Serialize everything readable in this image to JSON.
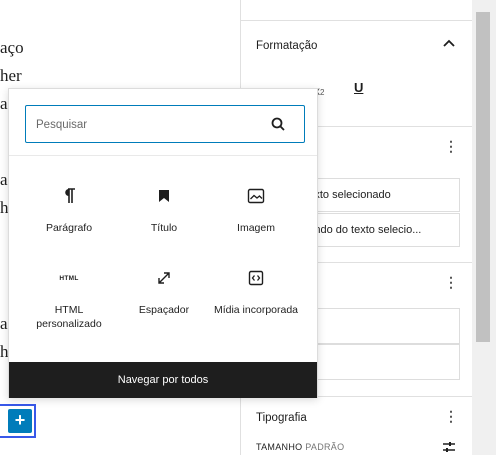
{
  "editor": {
    "fragments": [
      "aço",
      "her",
      "a",
      "ac",
      "h",
      "ac",
      "h"
    ],
    "add_label": "+"
  },
  "sidebar": {
    "formatting": {
      "title": "Formatação",
      "chevron": "^",
      "icons": [
        "subscript-icon",
        "underline-icon"
      ],
      "underline_label": "U"
    },
    "color_items": [
      "o texto selecionado",
      "e fundo do texto selecio..."
    ],
    "typography": {
      "title": "Tipografia",
      "size_label": "TAMANHO",
      "size_default": "PADRÃO"
    }
  },
  "inserter": {
    "search_placeholder": "Pesquisar",
    "blocks": [
      {
        "label": "Parágrafo",
        "icon": "paragraph-icon"
      },
      {
        "label": "Título",
        "icon": "bookmark-icon"
      },
      {
        "label": "Imagem",
        "icon": "image-icon"
      },
      {
        "label": "HTML personalizado",
        "icon": "html-icon",
        "icon_text": "HTML"
      },
      {
        "label": "Espaçador",
        "icon": "resize-arrows-icon"
      },
      {
        "label": "Mídia incorporada",
        "icon": "embed-icon"
      }
    ],
    "browse_all": "Navegar por todos"
  },
  "colors": {
    "accent": "#007cba",
    "browse_bg": "#1e1e1e"
  }
}
